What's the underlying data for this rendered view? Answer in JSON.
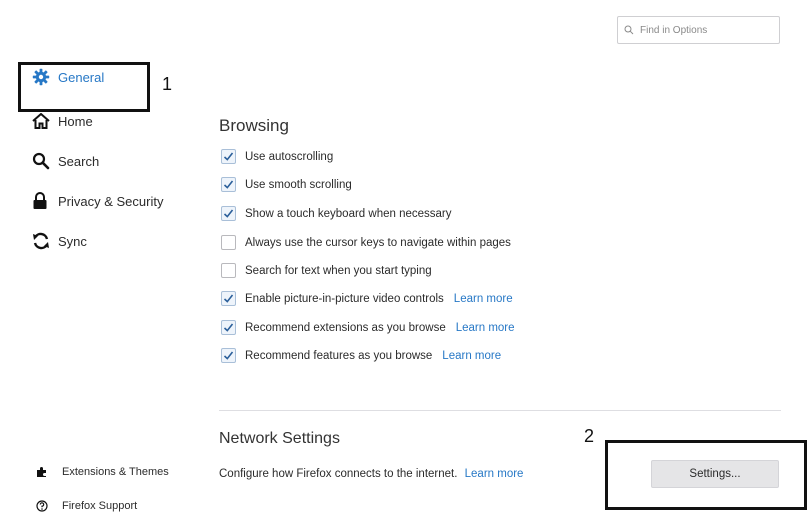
{
  "search": {
    "placeholder": "Find in Options"
  },
  "sidebar": {
    "items": [
      {
        "label": "General",
        "icon": "gear-icon",
        "active": true
      },
      {
        "label": "Home",
        "icon": "home-icon"
      },
      {
        "label": "Search",
        "icon": "search-icon"
      },
      {
        "label": "Privacy & Security",
        "icon": "lock-icon"
      },
      {
        "label": "Sync",
        "icon": "sync-icon"
      }
    ],
    "footer": [
      {
        "label": "Extensions & Themes",
        "icon": "puzzle-icon"
      },
      {
        "label": "Firefox Support",
        "icon": "help-icon"
      }
    ]
  },
  "annotations": {
    "first": "1",
    "second": "2"
  },
  "browsing": {
    "title": "Browsing",
    "options": [
      {
        "label": "Use autoscrolling",
        "checked": true
      },
      {
        "label": "Use smooth scrolling",
        "checked": true
      },
      {
        "label": "Show a touch keyboard when necessary",
        "checked": true
      },
      {
        "label": "Always use the cursor keys to navigate within pages",
        "checked": false
      },
      {
        "label": "Search for text when you start typing",
        "checked": false
      },
      {
        "label": "Enable picture-in-picture video controls",
        "checked": true,
        "learn_more": "Learn more"
      },
      {
        "label": "Recommend extensions as you browse",
        "checked": true,
        "learn_more": "Learn more"
      },
      {
        "label": "Recommend features as you browse",
        "checked": true,
        "learn_more": "Learn more"
      }
    ]
  },
  "network": {
    "title": "Network Settings",
    "description": "Configure how Firefox connects to the internet.",
    "learn_more": "Learn more",
    "button_label": "Settings..."
  },
  "colors": {
    "accent": "#2778c6",
    "check_bg": "#eef4fb"
  }
}
